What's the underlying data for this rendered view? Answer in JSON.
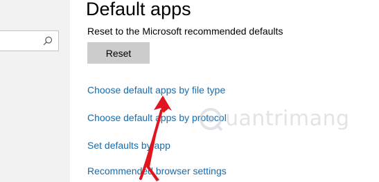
{
  "page": {
    "title": "Default apps",
    "reset_description": "Reset to the Microsoft recommended defaults",
    "reset_button_label": "Reset"
  },
  "links": [
    {
      "label": "Choose default apps by file type"
    },
    {
      "label": "Choose default apps by protocol"
    },
    {
      "label": "Set defaults by app"
    },
    {
      "label": "Recommended browser settings"
    }
  ],
  "sidebar": {
    "search_icon": "search-icon"
  },
  "overlay": {
    "watermark_text": "uantrimang",
    "watermark_icon": "quantrimang-logo-icon",
    "annotation": "red-arrow-icon"
  },
  "colors": {
    "link": "#1a6aa8",
    "button": "#cccccc",
    "sidebar": "#f2f2f2",
    "arrow": "#e0161e"
  }
}
